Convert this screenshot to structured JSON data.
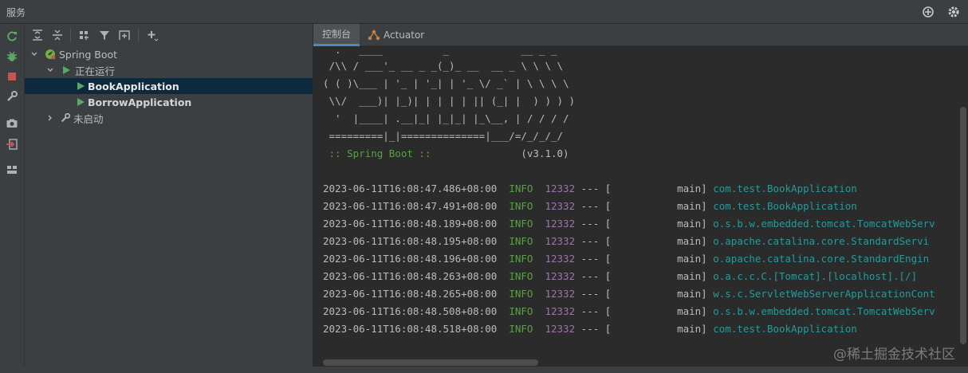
{
  "window": {
    "title": "服务",
    "icons": [
      "add-target-icon",
      "gear-icon"
    ]
  },
  "left_toolbar": {
    "icons": [
      "rerun-icon",
      "debug-icon",
      "stop-icon",
      "wrench-icon",
      "camera-icon",
      "exit-icon",
      "layout-icon"
    ]
  },
  "tree_toolbar": {
    "icons": [
      "expand-all-icon",
      "collapse-all-icon",
      "group-icon",
      "filter-icon",
      "new-tab-icon",
      "add-icon"
    ]
  },
  "tree": {
    "root": {
      "label": "Spring Boot",
      "icon": "spring-boot-icon"
    },
    "running_group": {
      "label": "正在运行",
      "icon": "run-icon"
    },
    "apps": [
      {
        "label": "BookApplication",
        "selected": true
      },
      {
        "label": "BorrowApplication",
        "selected": false
      }
    ],
    "stopped_group": {
      "label": "未启动",
      "icon": "wrench-icon"
    }
  },
  "tabs": [
    {
      "label": "控制台",
      "active": true
    },
    {
      "label": "Actuator",
      "icon": "actuator-icon",
      "active": false
    }
  ],
  "console": {
    "banner": [
      "  .   ____          _            __ _ _",
      " /\\\\ / ___'_ __ _ _(_)_ __  __ _ \\ \\ \\ \\",
      "( ( )\\___ | '_ | '_| | '_ \\/ _` | \\ \\ \\ \\",
      " \\\\/  ___)| |_)| | | | | || (_| |  ) ) ) )",
      "  '  |____| .__|_| |_|_| |_\\__, | / / / /",
      " =========|_|==============|___/=/_/_/_/"
    ],
    "spring_label": " :: Spring Boot :: ",
    "version": "              (v3.1.0)",
    "log_lines": [
      {
        "ts": "2023-06-11T16:08:47.486+08:00",
        "level": "INFO",
        "pid": "12332",
        "sep": " --- [",
        "thread": "           main] ",
        "logger": "com.test.BookApplication"
      },
      {
        "ts": "2023-06-11T16:08:47.491+08:00",
        "level": "INFO",
        "pid": "12332",
        "sep": " --- [",
        "thread": "           main] ",
        "logger": "com.test.BookApplication"
      },
      {
        "ts": "2023-06-11T16:08:48.189+08:00",
        "level": "INFO",
        "pid": "12332",
        "sep": " --- [",
        "thread": "           main] ",
        "logger": "o.s.b.w.embedded.tomcat.TomcatWebServ"
      },
      {
        "ts": "2023-06-11T16:08:48.195+08:00",
        "level": "INFO",
        "pid": "12332",
        "sep": " --- [",
        "thread": "           main] ",
        "logger": "o.apache.catalina.core.StandardServi"
      },
      {
        "ts": "2023-06-11T16:08:48.196+08:00",
        "level": "INFO",
        "pid": "12332",
        "sep": " --- [",
        "thread": "           main] ",
        "logger": "o.apache.catalina.core.StandardEngin"
      },
      {
        "ts": "2023-06-11T16:08:48.263+08:00",
        "level": "INFO",
        "pid": "12332",
        "sep": " --- [",
        "thread": "           main] ",
        "logger": "o.a.c.c.C.[Tomcat].[localhost].[/]"
      },
      {
        "ts": "2023-06-11T16:08:48.265+08:00",
        "level": "INFO",
        "pid": "12332",
        "sep": " --- [",
        "thread": "           main] ",
        "logger": "w.s.c.ServletWebServerApplicationCont"
      },
      {
        "ts": "2023-06-11T16:08:48.508+08:00",
        "level": "INFO",
        "pid": "12332",
        "sep": " --- [",
        "thread": "           main] ",
        "logger": "o.s.b.w.embedded.tomcat.TomcatWebServ"
      },
      {
        "ts": "2023-06-11T16:08:48.518+08:00",
        "level": "INFO",
        "pid": "12332",
        "sep": " --- [",
        "thread": "           main] ",
        "logger": "com.test.BookApplication"
      }
    ]
  },
  "watermark": "@稀土掘金技术社区",
  "colors": {
    "info": "#5c9f4a",
    "pid": "#9876aa",
    "logger": "#299999",
    "selection": "#0d293e",
    "accent": "#4a88c7"
  }
}
